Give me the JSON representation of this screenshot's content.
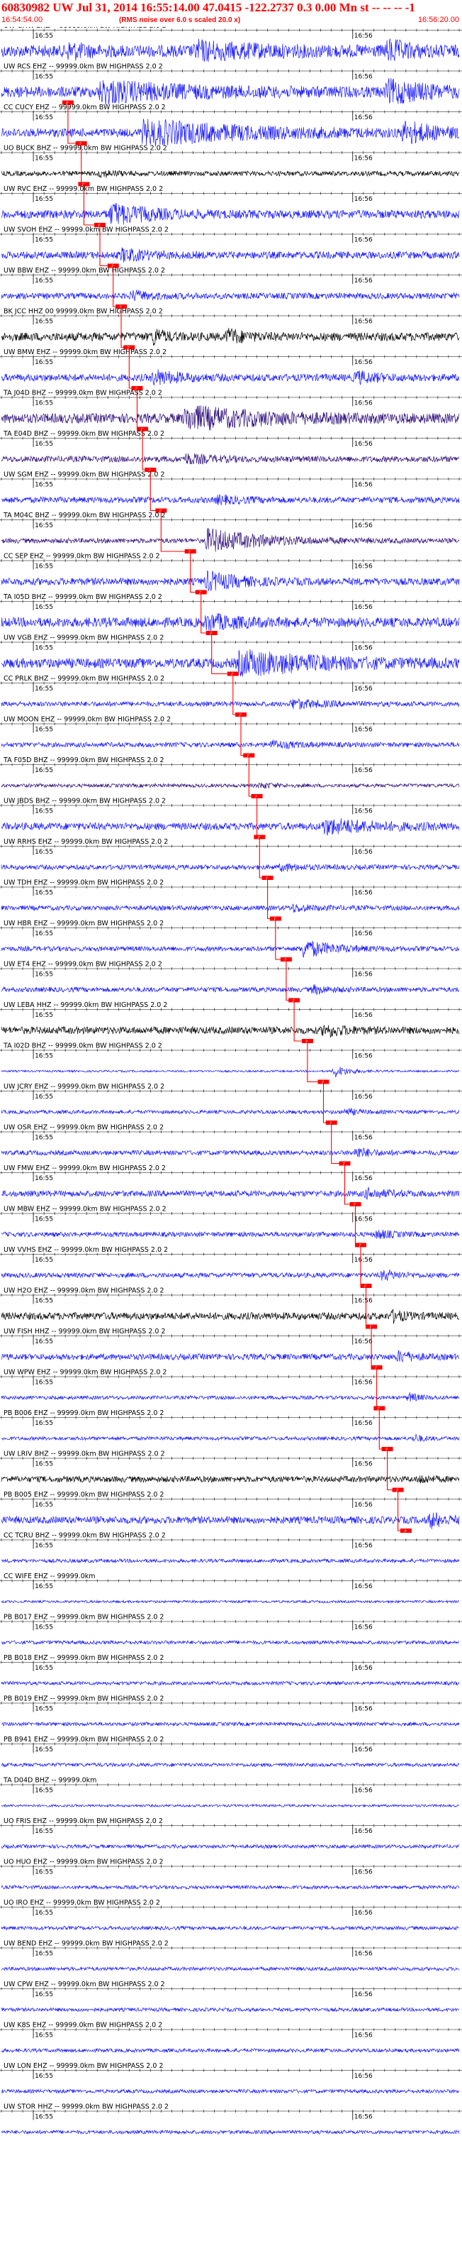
{
  "header": {
    "title": "60830982 UW Jul 31, 2014 16:55:14.00   47.0415 -122.2737  0.3 0.00 Mn st -- -- --  -1",
    "start_time": "16:54:54.00",
    "note": "(RMS noise over 6.0 s scaled 20.0 x)",
    "end_time": "16:56:20.00"
  },
  "chart_data": {
    "type": "line",
    "title": "60830982 UW Jul 31, 2014 16:55:14.00   47.0415 -122.2737  0.3 0.00 Mn st -- -- --  -1",
    "x_start": "16:54:54.00",
    "x_end": "16:56:20.00",
    "tick_labels": [
      "16:55",
      "16:56"
    ],
    "tick_times_s": [
      6,
      66
    ],
    "xlim_s": [
      0,
      86
    ],
    "colors": {
      "blue": "#1414ff",
      "black": "#000000",
      "purple": "#2a0a78",
      "pick": "#ff0000",
      "header": "#ff0000"
    },
    "pick_label": "P",
    "series": [
      {
        "name": "UW GHW EHZ -- 99999.0km BW  HIGHPASS  2.0  2",
        "color": "blue",
        "amp": 0.5,
        "bursts": [
          [
            12,
            6,
            0.7
          ],
          [
            36,
            25,
            0.6
          ],
          [
            72,
            8,
            0.9
          ]
        ],
        "pick_s": null
      },
      {
        "name": "UW RCS EHZ -- 99999.0km BW  HIGHPASS  2.0  2",
        "color": "blue",
        "amp": 0.45,
        "bursts": [
          [
            18,
            30,
            0.8
          ],
          [
            72,
            14,
            1.0
          ]
        ],
        "pick_s": 12.5
      },
      {
        "name": "CC CUCY EHZ -- 99999.0km BW  HIGHPASS  2.0  2",
        "color": "blue",
        "amp": 0.35,
        "bursts": [
          [
            26,
            40,
            1.0
          ],
          [
            75,
            12,
            0.9
          ]
        ],
        "pick_s": 15.0
      },
      {
        "name": "UO BUCK BHZ -- 99999.0km BW  HIGHPASS  2.0  2",
        "color": "black",
        "amp": 0.2,
        "bursts": [
          [
            18,
            6,
            0.3
          ]
        ],
        "pick_s": 15.5
      },
      {
        "name": "UW RVC EHZ -- 99999.0km BW  HIGHPASS  2.0  2",
        "color": "blue",
        "amp": 0.35,
        "bursts": [
          [
            20,
            14,
            0.9
          ]
        ],
        "pick_s": 18.5
      },
      {
        "name": "UW SVOH EHZ -- 99999.0km BW  HIGHPASS  2.0  2",
        "color": "blue",
        "amp": 0.3,
        "bursts": [
          [
            22,
            10,
            0.5
          ]
        ],
        "pick_s": 21.0
      },
      {
        "name": "UW BBW EHZ -- 99999.0km BW  HIGHPASS  2.0  2",
        "color": "blue",
        "amp": 0.25,
        "bursts": [
          [
            24,
            8,
            0.4
          ]
        ],
        "pick_s": 22.5
      },
      {
        "name": "BK JCC HHZ 00 99999.0km BW  HIGHPASS  2.0  2",
        "color": "black",
        "amp": 0.35,
        "bursts": [
          [
            28,
            4,
            0.9
          ],
          [
            42,
            6,
            0.7
          ]
        ],
        "pick_s": 24.0
      },
      {
        "name": "UW BMW EHZ -- 99999.0km BW  HIGHPASS  2.0  2",
        "color": "blue",
        "amp": 0.3,
        "bursts": [
          [
            28,
            10,
            0.6
          ],
          [
            66,
            8,
            0.5
          ]
        ],
        "pick_s": 25.5
      },
      {
        "name": "TA J04D BHZ -- 99999.0km BW  HIGHPASS  2.0  2",
        "color": "purple",
        "amp": 0.4,
        "bursts": [
          [
            34,
            30,
            0.9
          ]
        ],
        "pick_s": 26.5
      },
      {
        "name": "TA E04D BHZ -- 99999.0km BW  HIGHPASS  2.0  2",
        "color": "purple",
        "amp": 0.25,
        "bursts": [
          [
            34,
            10,
            0.4
          ]
        ],
        "pick_s": 28.0
      },
      {
        "name": "UW SGM EHZ -- 99999.0km BW  HIGHPASS  2.0  2",
        "color": "blue",
        "amp": 0.25,
        "bursts": [
          [
            40,
            10,
            0.3
          ]
        ],
        "pick_s": 30.0
      },
      {
        "name": "TA M04C BHZ -- 99999.0km BW  HIGHPASS  2.0  2",
        "color": "purple",
        "amp": 0.2,
        "bursts": [
          [
            38,
            22,
            1.0
          ]
        ],
        "pick_s": 35.5
      },
      {
        "name": "CC SEP EHZ -- 99999.0km BW  HIGHPASS  2.0  2",
        "color": "blue",
        "amp": 0.3,
        "bursts": [
          [
            38,
            12,
            0.8
          ]
        ],
        "pick_s": 37.5
      },
      {
        "name": "TA I05D BHZ -- 99999.0km BW  HIGHPASS  2.0  2",
        "color": "blue",
        "amp": 0.4,
        "bursts": [
          [
            38,
            12,
            0.6
          ]
        ],
        "pick_s": 39.5
      },
      {
        "name": "UW VGB EHZ -- 99999.0km BW  HIGHPASS  2.0  2",
        "color": "blue",
        "amp": 0.4,
        "bursts": [
          [
            44,
            30,
            1.0
          ]
        ],
        "pick_s": 43.5
      },
      {
        "name": "CC PRLK BHZ -- 99999.0km BW  HIGHPASS  2.0  2",
        "color": "blue",
        "amp": 0.2,
        "bursts": [
          [
            54,
            12,
            0.4
          ]
        ],
        "pick_s": 45.0
      },
      {
        "name": "UW MOON EHZ -- 99999.0km BW  HIGHPASS  2.0  2",
        "color": "blue",
        "amp": 0.2,
        "bursts": [
          [
            50,
            10,
            0.3
          ]
        ],
        "pick_s": 46.5
      },
      {
        "name": "TA F05D BHZ -- 99999.0km BW  HIGHPASS  2.0  2",
        "color": "purple",
        "amp": 0.15,
        "bursts": [
          [
            48,
            6,
            0.25
          ]
        ],
        "pick_s": 48.0
      },
      {
        "name": "UW JBDS BHZ -- 99999.0km BW  HIGHPASS  2.0  2",
        "color": "blue",
        "amp": 0.3,
        "bursts": [
          [
            60,
            20,
            0.6
          ]
        ],
        "pick_s": 48.5
      },
      {
        "name": "UW RRHS EHZ -- 99999.0km BW  HIGHPASS  2.0  2",
        "color": "blue",
        "amp": 0.2,
        "bursts": [
          [
            52,
            8,
            0.3
          ]
        ],
        "pick_s": 50.0
      },
      {
        "name": "UW TDH EHZ -- 99999.0km BW  HIGHPASS  2.0  2",
        "color": "blue",
        "amp": 0.2,
        "bursts": [
          [
            54,
            8,
            0.3
          ]
        ],
        "pick_s": 51.5
      },
      {
        "name": "UW HBR EHZ -- 99999.0km BW  HIGHPASS  2.0  2",
        "color": "blue",
        "amp": 0.2,
        "bursts": [
          [
            56,
            12,
            0.8
          ]
        ],
        "pick_s": 53.5
      },
      {
        "name": "UW ET4 EHZ -- 99999.0km BW  HIGHPASS  2.0  2",
        "color": "blue",
        "amp": 0.2,
        "bursts": [
          [
            58,
            6,
            0.4
          ]
        ],
        "pick_s": 55.0
      },
      {
        "name": "UW LEBA HHZ -- 99999.0km BW  HIGHPASS  2.0  2",
        "color": "black",
        "amp": 0.3,
        "bursts": [
          [
            60,
            8,
            0.5
          ]
        ],
        "pick_s": 57.5
      },
      {
        "name": "TA I02D BHZ -- 99999.0km BW  HIGHPASS  2.0  2",
        "color": "blue",
        "amp": 0.08,
        "bursts": [
          [
            62,
            6,
            0.6
          ]
        ],
        "pick_s": 60.5
      },
      {
        "name": "UW JCRY EHZ -- 99999.0km BW  HIGHPASS  2.0  2",
        "color": "blue",
        "amp": 0.15,
        "bursts": [
          [
            64,
            6,
            0.3
          ]
        ],
        "pick_s": 62.0
      },
      {
        "name": "UW OSR EHZ -- 99999.0km BW  HIGHPASS  2.0  2",
        "color": "blue",
        "amp": 0.2,
        "bursts": [
          [
            66,
            6,
            0.5
          ]
        ],
        "pick_s": 64.5
      },
      {
        "name": "UW FMW EHZ -- 99999.0km BW  HIGHPASS  2.0  2",
        "color": "blue",
        "amp": 0.25,
        "bursts": [
          [
            68,
            8,
            0.4
          ]
        ],
        "pick_s": 66.5
      },
      {
        "name": "UW MBW EHZ -- 99999.0km BW  HIGHPASS  2.0  2",
        "color": "blue",
        "amp": 0.2,
        "bursts": [
          [
            70,
            6,
            0.4
          ]
        ],
        "pick_s": 67.5
      },
      {
        "name": "UW VVHS EHZ -- 99999.0km BW  HIGHPASS  2.0  2",
        "color": "blue",
        "amp": 0.2,
        "bursts": [
          [
            71,
            6,
            0.5
          ]
        ],
        "pick_s": 68.5
      },
      {
        "name": "UW H2O EHZ -- 99999.0km BW  HIGHPASS  2.0  2",
        "color": "black",
        "amp": 0.3,
        "bursts": [
          [
            73,
            4,
            0.6
          ]
        ],
        "pick_s": 69.5
      },
      {
        "name": "UW FISH HHZ -- 99999.0km BW  HIGHPASS  2.0  2",
        "color": "blue",
        "amp": 0.25,
        "bursts": [
          [
            74,
            6,
            0.5
          ]
        ],
        "pick_s": 70.5
      },
      {
        "name": "UW WPW EHZ -- 99999.0km BW  HIGHPASS  2.0  2",
        "color": "blue",
        "amp": 0.15,
        "bursts": [
          [
            76,
            4,
            0.5
          ]
        ],
        "pick_s": 71.0
      },
      {
        "name": "PB B006 EHZ -- 99999.0km BW  HIGHPASS  2.0  2",
        "color": "blue",
        "amp": 0.15,
        "bursts": [
          [
            77,
            4,
            0.4
          ]
        ],
        "pick_s": 72.5
      },
      {
        "name": "UW LRIV BHZ -- 99999.0km BW  HIGHPASS  2.0  2",
        "color": "black",
        "amp": 0.25,
        "bursts": [
          [
            78,
            4,
            0.4
          ]
        ],
        "pick_s": 74.5
      },
      {
        "name": "PB B005 EHZ -- 99999.0km BW  HIGHPASS  2.0  2",
        "color": "blue",
        "amp": 0.3,
        "bursts": [
          [
            80,
            6,
            0.7
          ]
        ],
        "pick_s": 76.0
      },
      {
        "name": "CC TCRU BHZ -- 99999.0km BW  HIGHPASS  2.0  2",
        "color": "blue",
        "amp": 0.15,
        "bursts": [],
        "pick_s": null
      },
      {
        "name": "CC WIFE EHZ -- 99999.0km",
        "color": "blue",
        "amp": 0.1,
        "bursts": [],
        "pick_s": null
      },
      {
        "name": "PB B017 EHZ -- 99999.0km BW  HIGHPASS  2.0  2",
        "color": "blue",
        "amp": 0.15,
        "bursts": [],
        "pick_s": null
      },
      {
        "name": "PB B018 EHZ -- 99999.0km BW  HIGHPASS  2.0  2",
        "color": "blue",
        "amp": 0.15,
        "bursts": [],
        "pick_s": null
      },
      {
        "name": "PB B019 EHZ -- 99999.0km BW  HIGHPASS  2.0  2",
        "color": "blue",
        "amp": 0.15,
        "bursts": [],
        "pick_s": null
      },
      {
        "name": "PB B941 EHZ -- 99999.0km BW  HIGHPASS  2.0  2",
        "color": "blue",
        "amp": 0.15,
        "bursts": [],
        "pick_s": null
      },
      {
        "name": "TA D04D BHZ -- 99999.0km",
        "color": "blue",
        "amp": 0.1,
        "bursts": [],
        "pick_s": null
      },
      {
        "name": "UO FRIS EHZ -- 99999.0km BW  HIGHPASS  2.0  2",
        "color": "blue",
        "amp": 0.15,
        "bursts": [],
        "pick_s": null
      },
      {
        "name": "UO HUO EHZ -- 99999.0km BW  HIGHPASS  2.0  2",
        "color": "blue",
        "amp": 0.15,
        "bursts": [],
        "pick_s": null
      },
      {
        "name": "UO IRO EHZ -- 99999.0km BW  HIGHPASS  2.0  2",
        "color": "blue",
        "amp": 0.15,
        "bursts": [],
        "pick_s": null
      },
      {
        "name": "UW BEND EHZ -- 99999.0km BW  HIGHPASS  2.0  2",
        "color": "blue",
        "amp": 0.15,
        "bursts": [],
        "pick_s": null
      },
      {
        "name": "UW CPW EHZ -- 99999.0km BW  HIGHPASS  2.0  2",
        "color": "blue",
        "amp": 0.15,
        "bursts": [],
        "pick_s": null
      },
      {
        "name": "UW K8S EHZ -- 99999.0km BW  HIGHPASS  2.0  2",
        "color": "blue",
        "amp": 0.15,
        "bursts": [],
        "pick_s": null
      },
      {
        "name": "UW LON EHZ -- 99999.0km BW  HIGHPASS  2.0  2",
        "color": "blue",
        "amp": 0.15,
        "bursts": [],
        "pick_s": null
      },
      {
        "name": "UW STOR HHZ -- 99999.0km BW  HIGHPASS  2.0  2",
        "color": "blue",
        "amp": 0.15,
        "bursts": [],
        "pick_s": null
      }
    ]
  }
}
